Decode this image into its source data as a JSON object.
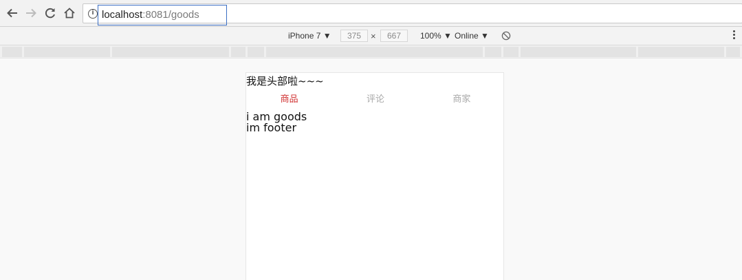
{
  "browser": {
    "url_host": "localhost",
    "url_path": ":8081/goods"
  },
  "devtools": {
    "device": "iPhone 7 ▼",
    "width": "375",
    "separator": "×",
    "height": "667",
    "zoom": "100% ▼",
    "network": "Online ▼"
  },
  "app": {
    "header": "我是头部啦~~~",
    "tabs": [
      {
        "label": "商品",
        "active": true
      },
      {
        "label": "评论",
        "active": false
      },
      {
        "label": "商家",
        "active": false
      }
    ],
    "goods_text": "i am goods",
    "footer_text": "im footer",
    "active_color": "#d03030",
    "inactive_color": "#a8a8a8"
  }
}
